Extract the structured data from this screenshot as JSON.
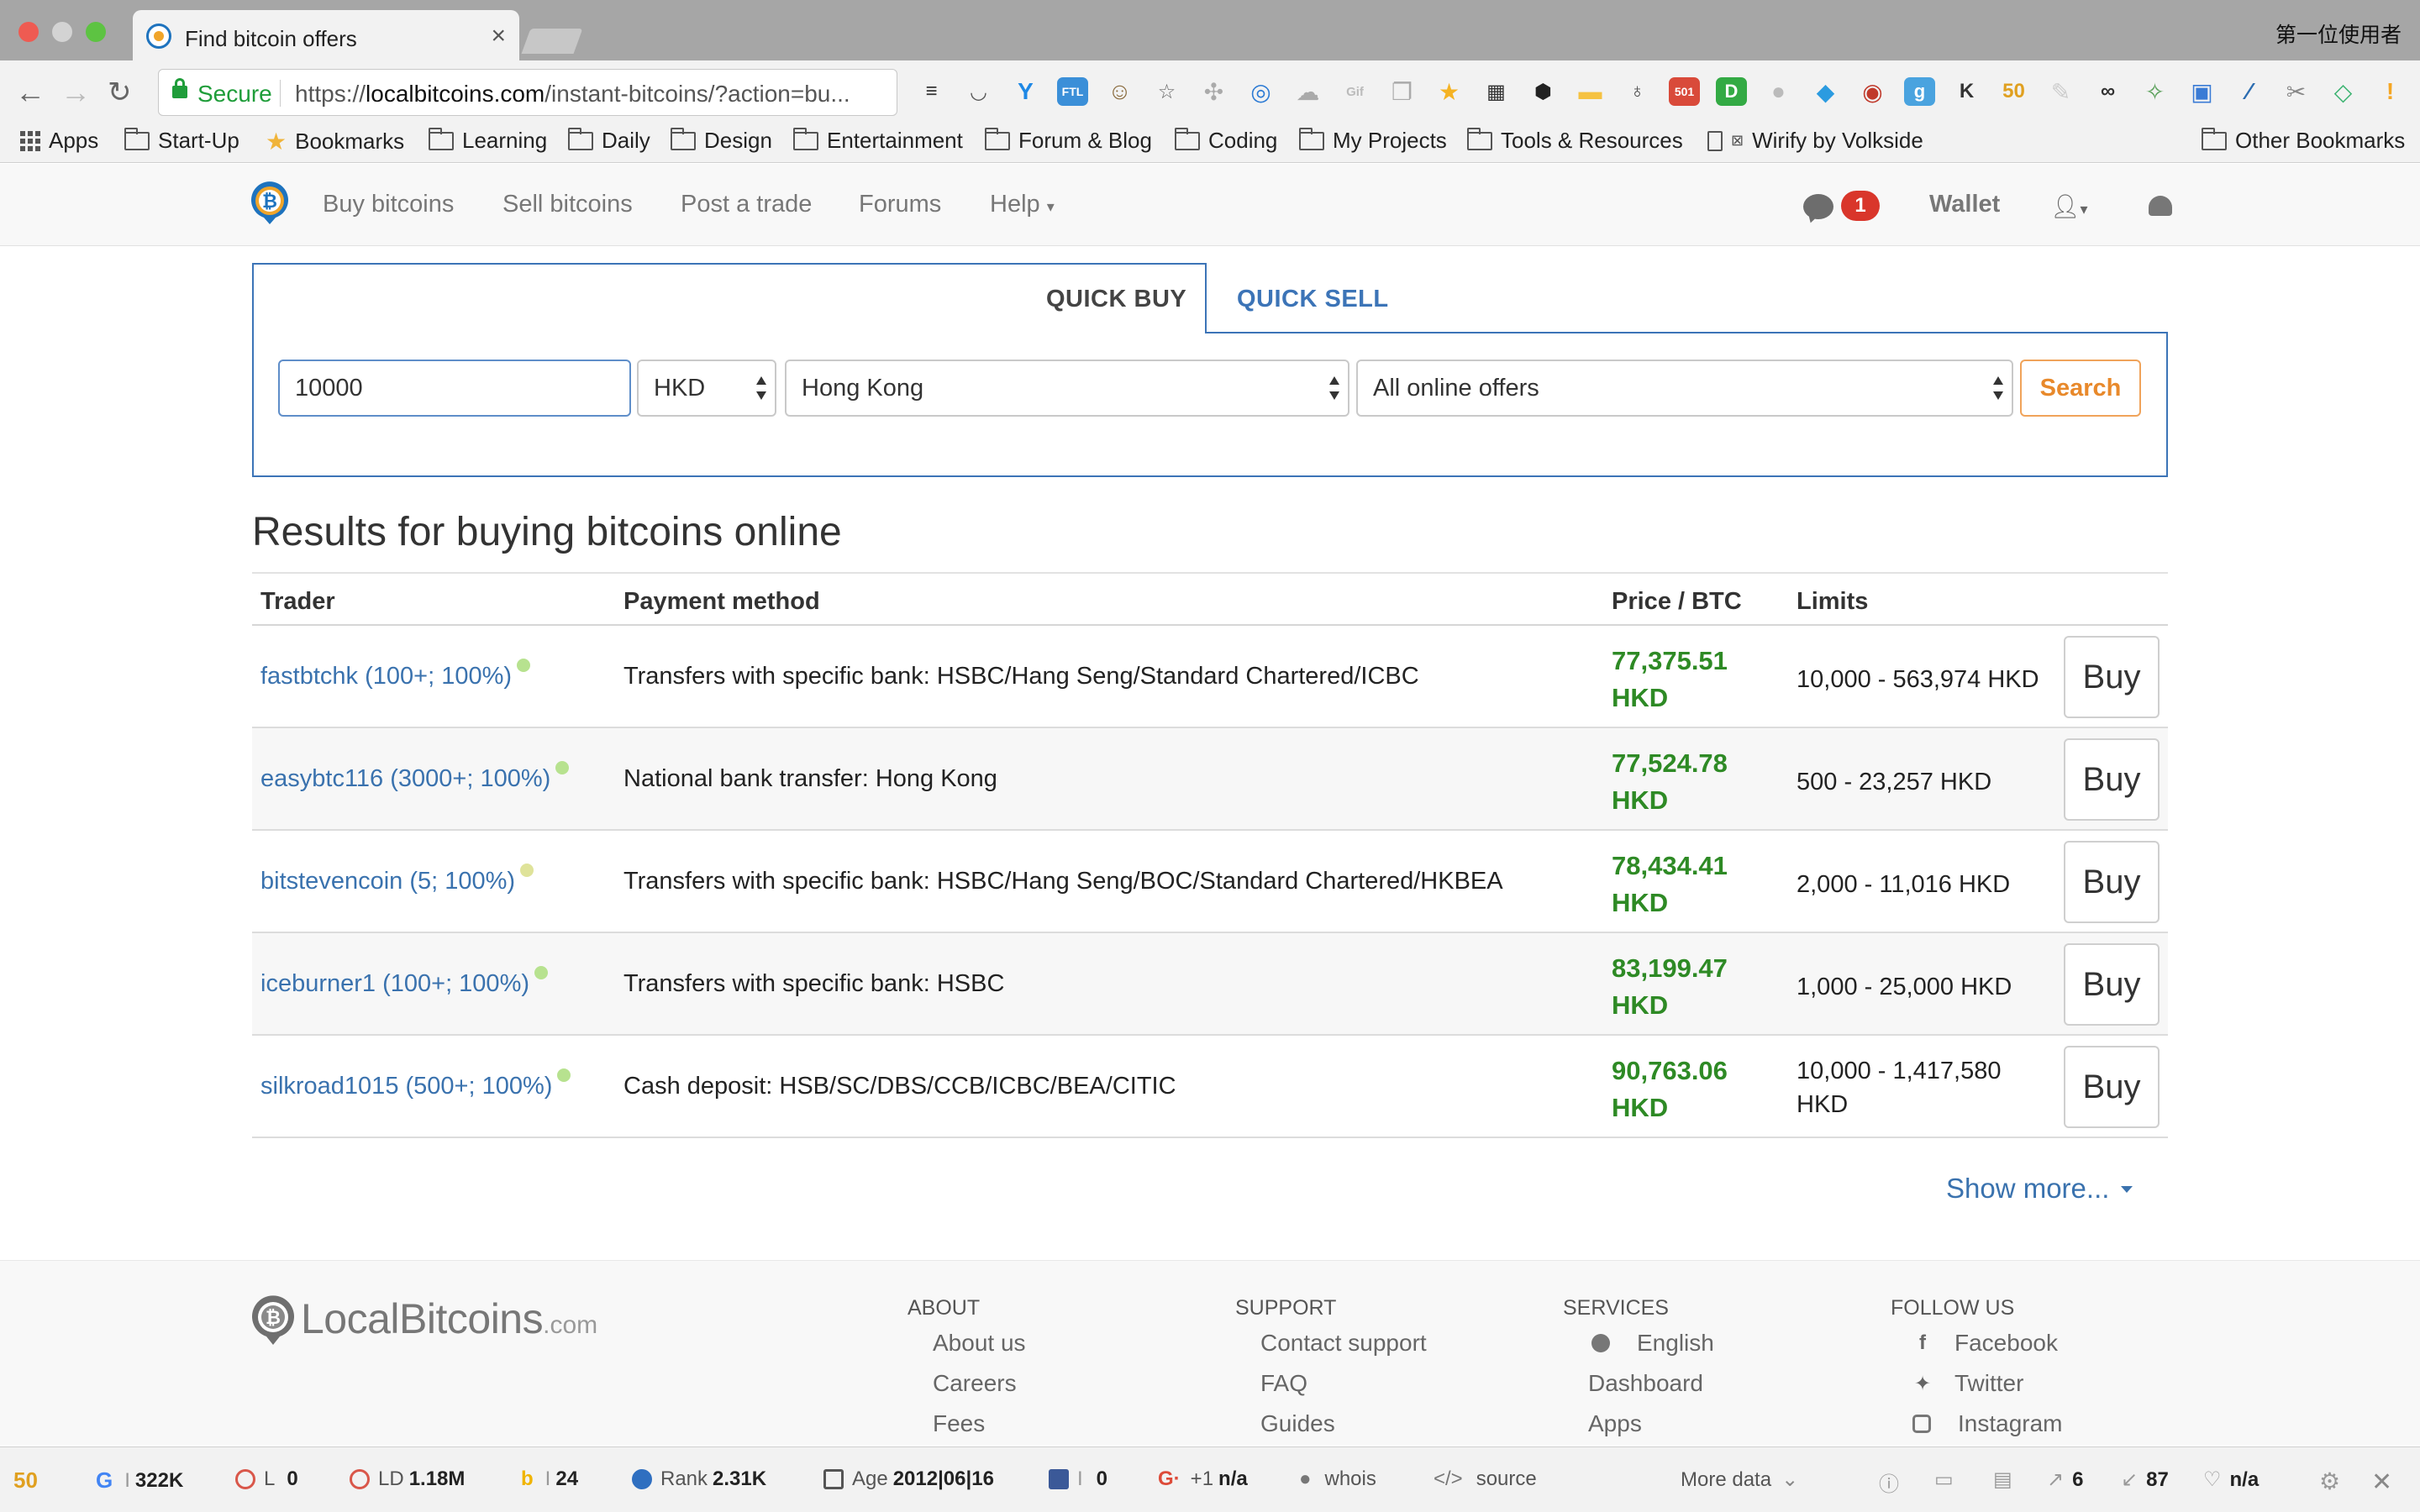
{
  "browser": {
    "tab_title": "Find bitcoin offers",
    "tab_close": "×",
    "user_profile": "第一位使用者",
    "secure_label": "Secure",
    "url_prefix": "https://",
    "url_host": "localbitcoins.com",
    "url_path": "/instant-bitcoins/?action=bu...",
    "extensions": [
      {
        "name": "layers-icon",
        "glyph": "≡",
        "color": "#333333"
      },
      {
        "name": "pocket-icon",
        "glyph": "◡",
        "color": "#555555"
      },
      {
        "name": "ycombinator-icon",
        "glyph": "Y",
        "color": "#1e88e5"
      },
      {
        "name": "ftl-icon",
        "glyph": "FTL",
        "color": "#3b8fd8"
      },
      {
        "name": "ghostery-icon",
        "glyph": "☺",
        "color": "#8a6b3e"
      },
      {
        "name": "star-icon",
        "glyph": "☆",
        "color": "#666666"
      },
      {
        "name": "puzzle-icon",
        "glyph": "✣",
        "color": "#aaaaaa"
      },
      {
        "name": "compass-icon",
        "glyph": "◎",
        "color": "#2d7bd4"
      },
      {
        "name": "cloud-icon",
        "glyph": "☁",
        "color": "#aaaaaa"
      },
      {
        "name": "gif-icon",
        "glyph": "Gif",
        "color": "#bbbbbb"
      },
      {
        "name": "copy-icon",
        "glyph": "❐",
        "color": "#aaaaaa"
      },
      {
        "name": "badge-icon",
        "glyph": "★",
        "color": "#f5b323"
      },
      {
        "name": "film-icon",
        "glyph": "▦",
        "color": "#333333"
      },
      {
        "name": "hexagon-icon",
        "glyph": "⬢",
        "color": "#222222"
      },
      {
        "name": "chat-bubble-icon",
        "glyph": "▬",
        "color": "#f5c242"
      },
      {
        "name": "bulb-icon",
        "glyph": "♁",
        "color": "#444444"
      },
      {
        "name": "counter-icon",
        "glyph": "501",
        "color": "#d94a3a"
      },
      {
        "name": "d-icon",
        "glyph": "D",
        "color": "#33aa44"
      },
      {
        "name": "grey-circle-icon",
        "glyph": "●",
        "color": "#bbbbbb"
      },
      {
        "name": "blue-hex-icon",
        "glyph": "◆",
        "color": "#2b9be0"
      },
      {
        "name": "ball-icon",
        "glyph": "◉",
        "color": "#c0392b"
      },
      {
        "name": "g-icon",
        "glyph": "g",
        "color": "#4aa3df"
      },
      {
        "name": "k-icon",
        "glyph": "K",
        "color": "#333333"
      },
      {
        "name": "seo-50-icon",
        "glyph": "50",
        "color": "#e0a020"
      },
      {
        "name": "tool-icon",
        "glyph": "✎",
        "color": "#cccccc"
      },
      {
        "name": "mask-icon",
        "glyph": "∞",
        "color": "#333333"
      },
      {
        "name": "bird-icon",
        "glyph": "✧",
        "color": "#5aa05a"
      },
      {
        "name": "screen-icon",
        "glyph": "▣",
        "color": "#3a7bd5"
      },
      {
        "name": "pen-icon",
        "glyph": "⁄",
        "color": "#2b6cb0"
      },
      {
        "name": "scissors-icon",
        "glyph": "✂",
        "color": "#888888"
      },
      {
        "name": "diamond-icon",
        "glyph": "◇",
        "color": "#3cb371"
      },
      {
        "name": "alert-icon",
        "glyph": "!",
        "color": "#f5a623"
      }
    ],
    "bookmarks": [
      "Apps",
      "Start-Up",
      "Bookmarks",
      "Learning",
      "Daily",
      "Design",
      "Entertainment",
      "Forum & Blog",
      "Coding",
      "My Projects",
      "Tools & Resources",
      "Wirify by Volkside",
      "Other Bookmarks"
    ]
  },
  "site_nav": {
    "buy": "Buy bitcoins",
    "sell": "Sell bitcoins",
    "post": "Post a trade",
    "forums": "Forums",
    "help": "Help",
    "chat_count": "1",
    "wallet": "Wallet"
  },
  "quick": {
    "tab_buy": "QUICK BUY",
    "tab_sell": "QUICK SELL",
    "amount": "10000",
    "currency": "HKD",
    "country": "Hong Kong",
    "offer_type": "All online offers",
    "search": "Search"
  },
  "results": {
    "title": "Results for buying bitcoins online",
    "headers": {
      "trader": "Trader",
      "payment": "Payment method",
      "price": "Price / BTC",
      "limits": "Limits"
    },
    "buy_label": "Buy",
    "rows": [
      {
        "trader": "fastbtchk (100+; 100%)",
        "payment": "Transfers with specific bank: HSBC/Hang Seng/Standard Chartered/ICBC",
        "price": "77,375.51",
        "currency": "HKD",
        "limits": "10,000 - 563,974 HKD"
      },
      {
        "trader": "easybtc116 (3000+; 100%)",
        "payment": "National bank transfer: Hong Kong",
        "price": "77,524.78",
        "currency": "HKD",
        "limits": "500 - 23,257 HKD"
      },
      {
        "trader": "bitstevencoin (5; 100%)",
        "payment": "Transfers with specific bank: HSBC/Hang Seng/BOC/Standard Chartered/HKBEA",
        "price": "78,434.41",
        "currency": "HKD",
        "limits": "2,000 - 11,016 HKD"
      },
      {
        "trader": "iceburner1 (100+; 100%)",
        "payment": "Transfers with specific bank: HSBC",
        "price": "83,199.47",
        "currency": "HKD",
        "limits": "1,000 - 25,000 HKD"
      },
      {
        "trader": "silkroad1015 (500+; 100%)",
        "payment": "Cash deposit: HSB/SC/DBS/CCB/ICBC/BEA/CITIC",
        "price": "90,763.06",
        "currency": "HKD",
        "limits": "10,000 - 1,417,580 HKD"
      }
    ],
    "show_more": "Show more..."
  },
  "footer": {
    "logo_main": "LocalBitcoins",
    "logo_suffix": ".com",
    "about": {
      "title": "ABOUT",
      "links": [
        "About us",
        "Careers",
        "Fees"
      ]
    },
    "support": {
      "title": "SUPPORT",
      "links": [
        "Contact support",
        "FAQ",
        "Guides"
      ]
    },
    "services": {
      "title": "SERVICES",
      "links": [
        "English",
        "Dashboard",
        "Apps"
      ]
    },
    "follow": {
      "title": "FOLLOW US",
      "links": [
        "Facebook",
        "Twitter",
        "Instagram"
      ]
    }
  },
  "seobar": {
    "google": "322K",
    "links_label": "L",
    "links": "0",
    "ld_label": "LD",
    "ld": "1.18M",
    "bing": "24",
    "rank_label": "Rank",
    "rank": "2.31K",
    "age_label": "Age",
    "age": "2012|06|16",
    "facebook": "0",
    "gplus_label": "+1",
    "gplus": "n/a",
    "whois": "whois",
    "source": "source",
    "more_data": "More data",
    "external": "6",
    "internal": "87",
    "other": "n/a"
  }
}
